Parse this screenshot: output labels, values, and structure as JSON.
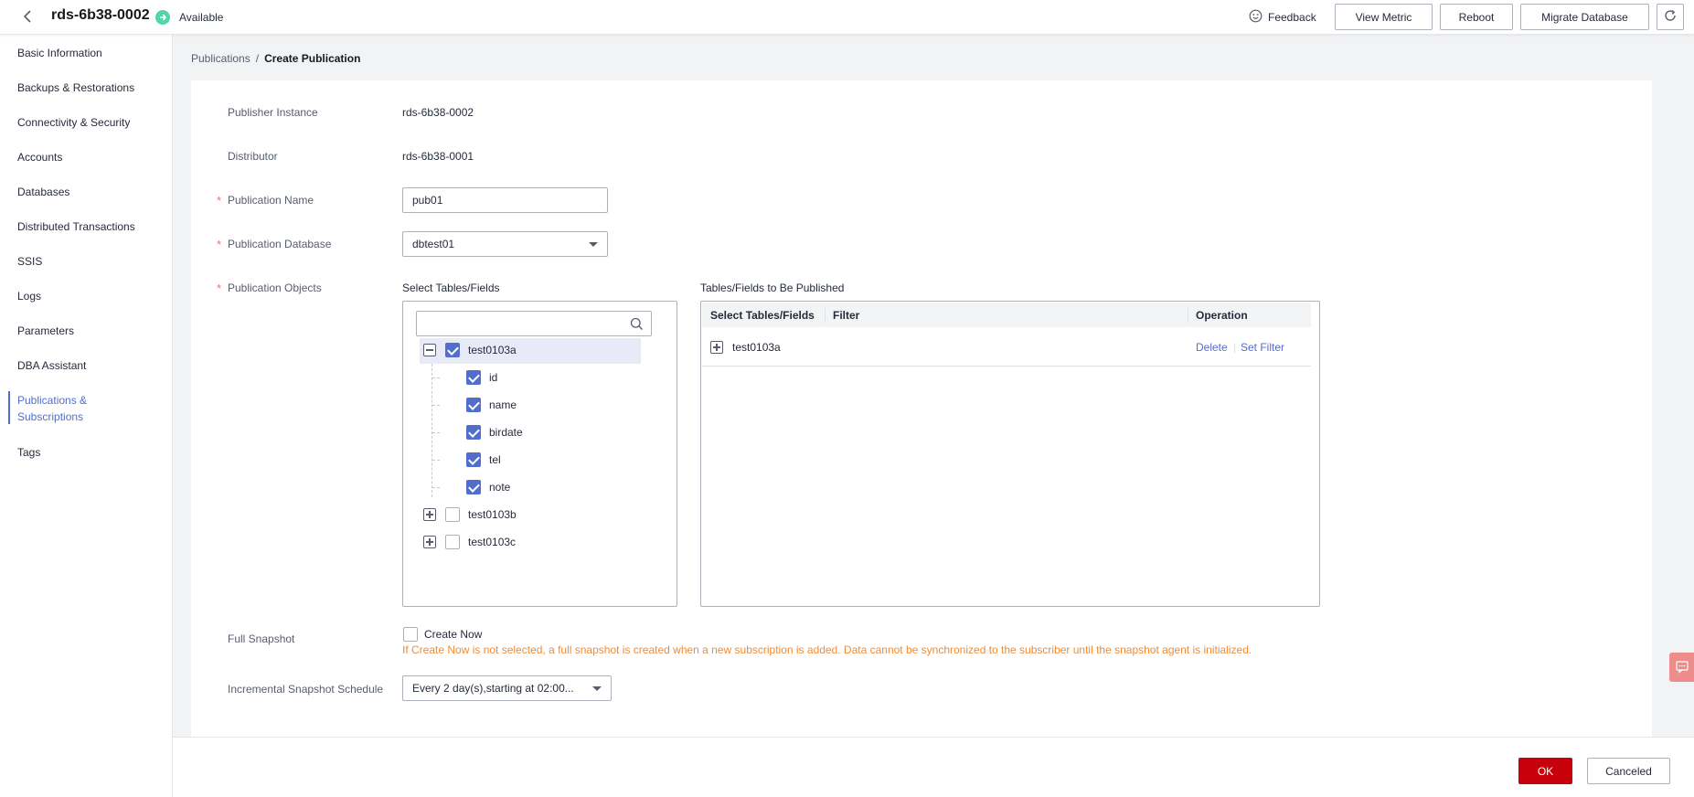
{
  "header": {
    "instance_name": "rds-6b38-0002",
    "status": "Available",
    "feedback_label": "Feedback",
    "buttons": {
      "view_metric": "View Metric",
      "reboot": "Reboot",
      "migrate_database": "Migrate Database"
    }
  },
  "sidebar": {
    "items": [
      {
        "label": "Basic Information"
      },
      {
        "label": "Backups & Restorations"
      },
      {
        "label": "Connectivity & Security"
      },
      {
        "label": "Accounts"
      },
      {
        "label": "Databases"
      },
      {
        "label": "Distributed Transactions"
      },
      {
        "label": "SSIS"
      },
      {
        "label": "Logs"
      },
      {
        "label": "Parameters"
      },
      {
        "label": "DBA Assistant"
      },
      {
        "label": "Publications & Subscriptions",
        "line1": "Publications &",
        "line2": "Subscriptions",
        "active": true
      },
      {
        "label": "Tags"
      }
    ]
  },
  "breadcrumb": {
    "parent": "Publications",
    "separator": "/",
    "current": "Create Publication"
  },
  "form": {
    "publisher_instance": {
      "label": "Publisher Instance",
      "value": "rds-6b38-0002"
    },
    "distributor": {
      "label": "Distributor",
      "value": "rds-6b38-0001"
    },
    "publication_name": {
      "label": "Publication Name",
      "value": "pub01",
      "required": true
    },
    "publication_database": {
      "label": "Publication Database",
      "value": "dbtest01",
      "required": true
    },
    "publication_objects": {
      "label": "Publication Objects",
      "required": true,
      "select_title": "Select Tables/Fields",
      "published_title": "Tables/Fields to Be Published",
      "search_placeholder": "",
      "tree": [
        {
          "name": "test0103a",
          "expanded": true,
          "checked": true,
          "fields": [
            {
              "name": "id",
              "checked": true
            },
            {
              "name": "name",
              "checked": true
            },
            {
              "name": "birdate",
              "checked": true
            },
            {
              "name": "tel",
              "checked": true
            },
            {
              "name": "note",
              "checked": true
            }
          ]
        },
        {
          "name": "test0103b",
          "expanded": false,
          "checked": false
        },
        {
          "name": "test0103c",
          "expanded": false,
          "checked": false
        }
      ],
      "table_columns": [
        "Select Tables/Fields",
        "Filter",
        "Operation"
      ],
      "rows": [
        {
          "name": "test0103a",
          "filter": "",
          "delete": "Delete",
          "separator": "|",
          "set_filter": "Set Filter"
        }
      ]
    },
    "full_snapshot": {
      "label": "Full Snapshot",
      "checkbox_label": "Create Now",
      "checked": false,
      "hint": "If Create Now is not selected, a full snapshot is created when a new subscription is added. Data cannot be synchronized to the subscriber until the snapshot agent is initialized."
    },
    "incremental_schedule": {
      "label": "Incremental Snapshot Schedule",
      "value": "Every 2 day(s),starting at 02:00..."
    }
  },
  "footer": {
    "ok": "OK",
    "cancel": "Canceled"
  },
  "colors": {
    "accent": "#526ecc",
    "primary_button": "#c7000b",
    "status_available": "#50d4ab",
    "hint": "#f28b33",
    "required": "#f66f6a"
  },
  "icons": {
    "back": "chevron-left-icon",
    "status": "arrow-right-circle-icon",
    "feedback": "smiley-icon",
    "refresh": "refresh-icon",
    "search": "search-icon",
    "float_tab": "chat-icon"
  }
}
